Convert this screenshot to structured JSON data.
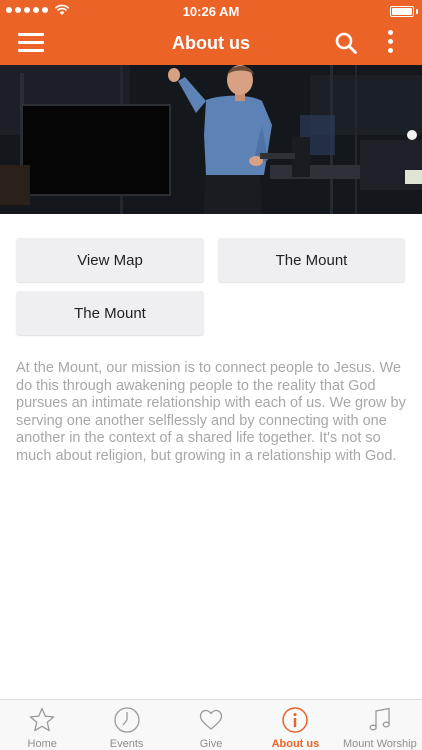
{
  "status_bar": {
    "time": "10:26 AM"
  },
  "header": {
    "title": "About us"
  },
  "buttons": {
    "view_map": "View Map",
    "the_mount_1": "The Mount",
    "the_mount_2": "The Mount"
  },
  "about": {
    "text": "At the Mount, our mission is to connect people to Jesus. We do this through awakening people to the reality that God pursues an intimate relationship with each of us.  We grow by serving one another selflessly and by connecting with one another in the context of a shared life together. It's not so much about religion, but growing in a relationship with God."
  },
  "tabs": [
    {
      "label": "Home",
      "icon": "star-icon"
    },
    {
      "label": "Events",
      "icon": "clock-icon"
    },
    {
      "label": "Give",
      "icon": "heart-icon"
    },
    {
      "label": "About us",
      "icon": "info-icon",
      "active": true
    },
    {
      "label": "Mount Worship",
      "icon": "music-note-icon"
    }
  ],
  "colors": {
    "accent": "#ec6327",
    "tab_inactive": "#8e8e8e",
    "button_bg": "#efeff1",
    "body_text": "#a7a7a7"
  }
}
